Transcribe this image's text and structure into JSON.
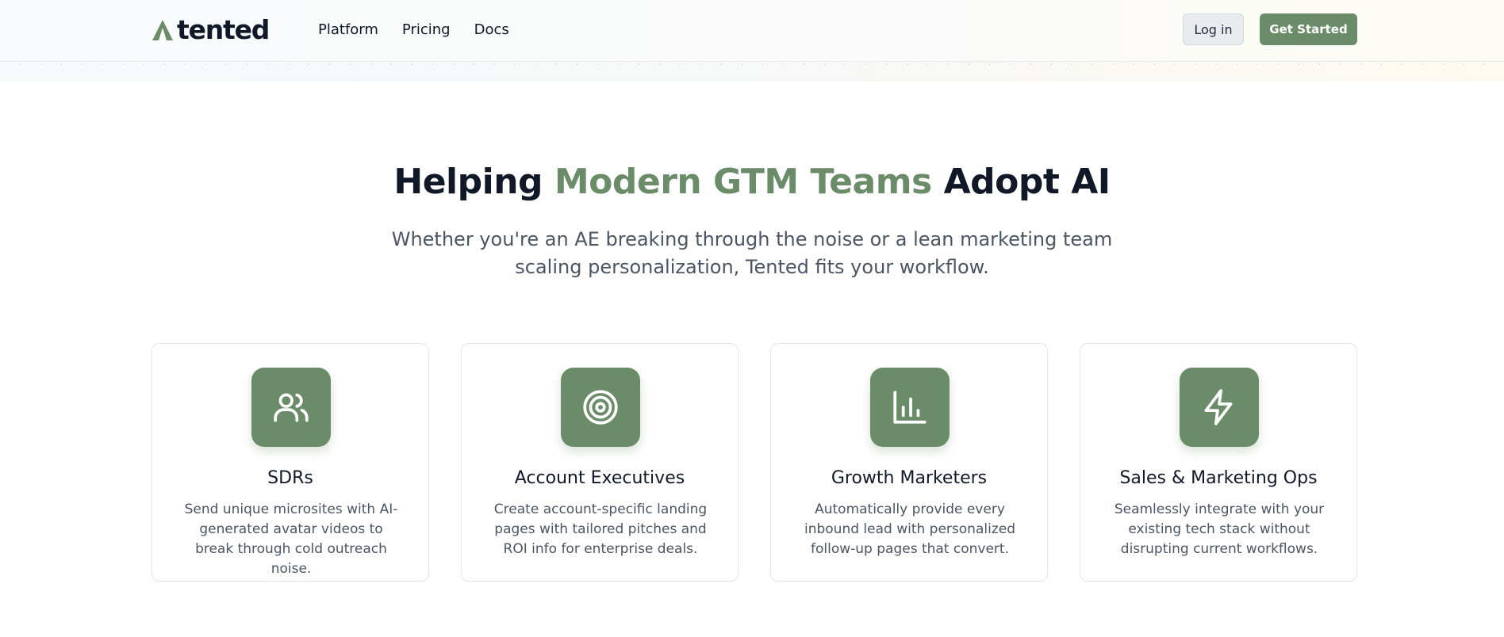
{
  "brand": {
    "name": "tented",
    "accent_color": "#6b8c68"
  },
  "nav": {
    "items": [
      {
        "label": "Platform"
      },
      {
        "label": "Pricing"
      },
      {
        "label": "Docs"
      }
    ]
  },
  "header_actions": {
    "login_label": "Log in",
    "cta_label": "Get Started"
  },
  "hero": {
    "title_before": "Helping ",
    "title_accent": "Modern GTM Teams",
    "title_after": " Adopt AI",
    "subtitle": "Whether you're an AE breaking through the noise or a lean marketing team scaling personalization, Tented fits your workflow."
  },
  "cards": [
    {
      "icon": "users-icon",
      "title": "SDRs",
      "description": "Send unique microsites with AI-generated avatar videos to break through cold outreach noise."
    },
    {
      "icon": "target-icon",
      "title": "Account Executives",
      "description": "Create account-specific landing pages with tailored pitches and ROI info for enterprise deals."
    },
    {
      "icon": "bar-chart-icon",
      "title": "Growth Marketers",
      "description": "Automatically provide every inbound lead with personalized follow-up pages that convert."
    },
    {
      "icon": "lightning-icon",
      "title": "Sales & Marketing Ops",
      "description": "Seamlessly integrate with your existing tech stack without disrupting current workflows."
    }
  ]
}
